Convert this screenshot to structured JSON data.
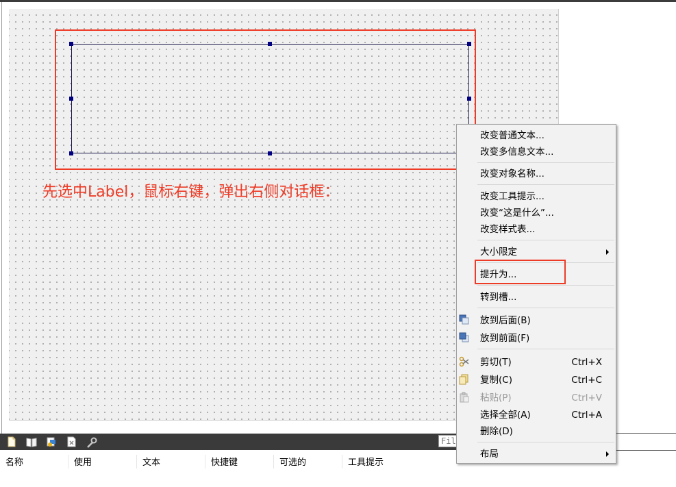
{
  "annotation": {
    "instruction_text": "先选中Label，鼠标右键，弹出右侧对话框：",
    "color": "#ee3b26"
  },
  "context_menu": {
    "items": [
      {
        "label": "改变普通文本...",
        "shortcut": "",
        "enabled": true
      },
      {
        "label": "改变多信息文本...",
        "shortcut": "",
        "enabled": true
      },
      {
        "label": "改变对象名称...",
        "shortcut": "",
        "enabled": true
      },
      {
        "label": "改变工具提示...",
        "shortcut": "",
        "enabled": true
      },
      {
        "label": "改变“这是什么”...",
        "shortcut": "",
        "enabled": true
      },
      {
        "label": "改变样式表...",
        "shortcut": "",
        "enabled": true
      },
      {
        "label": "大小限定",
        "shortcut": "",
        "enabled": true,
        "submenu": true
      },
      {
        "label": "提升为...",
        "shortcut": "",
        "enabled": true,
        "highlighted": true
      },
      {
        "label": "转到槽...",
        "shortcut": "",
        "enabled": true
      },
      {
        "label": "放到后面(B)",
        "shortcut": "",
        "enabled": true,
        "icon": "send-back-icon"
      },
      {
        "label": "放到前面(F)",
        "shortcut": "",
        "enabled": true,
        "icon": "bring-front-icon"
      },
      {
        "label": "剪切(T)",
        "shortcut": "Ctrl+X",
        "enabled": true,
        "icon": "scissors-icon"
      },
      {
        "label": "复制(C)",
        "shortcut": "Ctrl+C",
        "enabled": true,
        "icon": "copy-icon"
      },
      {
        "label": "粘贴(P)",
        "shortcut": "Ctrl+V",
        "enabled": false,
        "icon": "paste-icon"
      },
      {
        "label": "选择全部(A)",
        "shortcut": "Ctrl+A",
        "enabled": true
      },
      {
        "label": "删除(D)",
        "shortcut": "",
        "enabled": true
      },
      {
        "label": "布局",
        "shortcut": "",
        "enabled": true,
        "submenu": true
      }
    ]
  },
  "bottom_panel": {
    "toolbar_icons": [
      "new-document-icon",
      "open-book-icon",
      "resource-icon",
      "close-file-icon",
      "wrench-icon"
    ],
    "filter_value": "Fil",
    "columns": [
      "名称",
      "使用",
      "文本",
      "快捷键",
      "可选的",
      "工具提示"
    ]
  },
  "colors": {
    "highlight_red": "#ee3b26",
    "selection_handle": "#000080",
    "canvas_background": "#f0f0f0"
  }
}
